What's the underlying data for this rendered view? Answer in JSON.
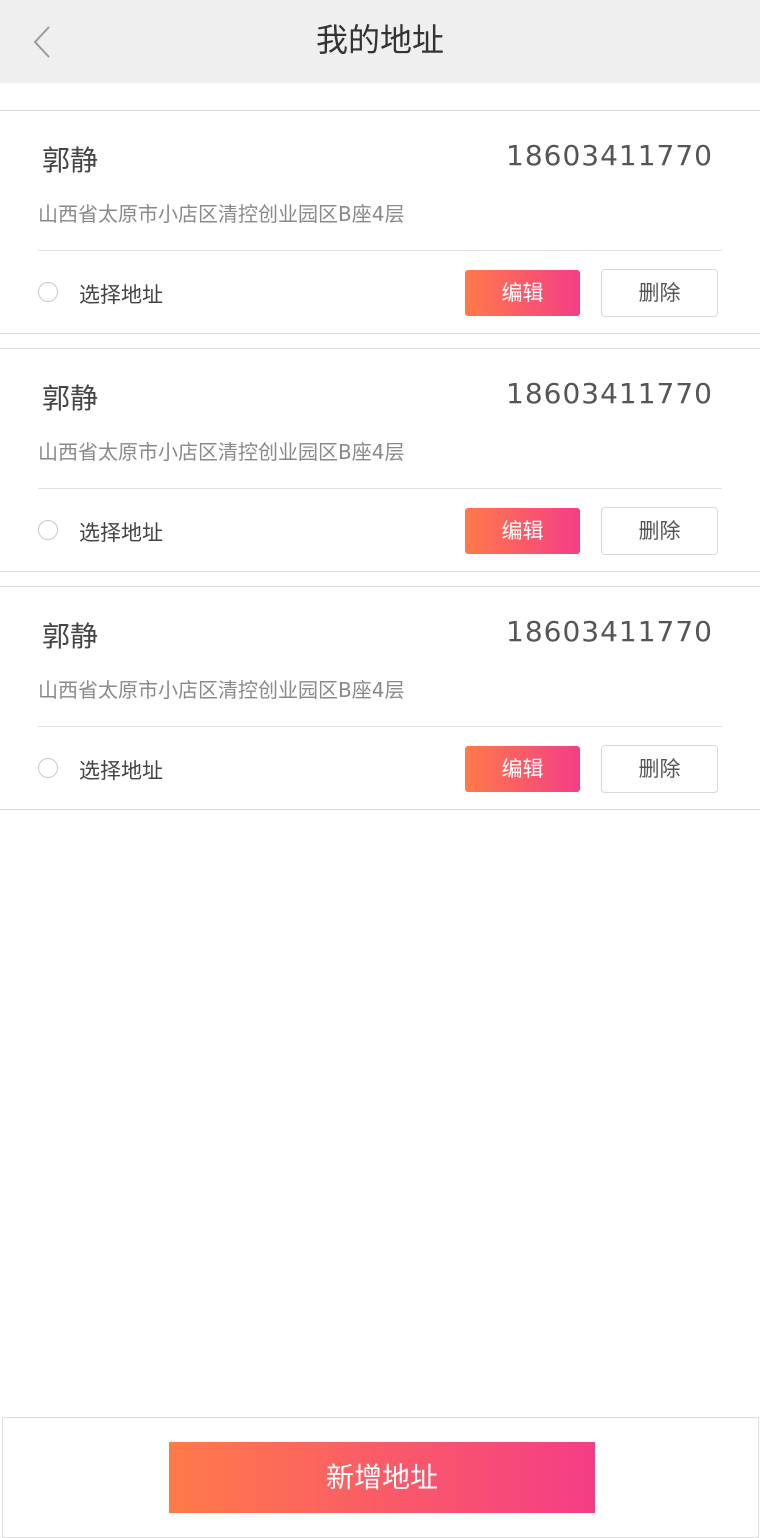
{
  "header": {
    "title": "我的地址",
    "back_icon": "chevron-left-icon"
  },
  "addresses": [
    {
      "name": "郭静",
      "phone": "18603411770",
      "address": "山西省太原市小店区清控创业园区B座4层",
      "select_label": "选择地址",
      "edit_label": "编辑",
      "delete_label": "删除"
    },
    {
      "name": "郭静",
      "phone": "18603411770",
      "address": "山西省太原市小店区清控创业园区B座4层",
      "select_label": "选择地址",
      "edit_label": "编辑",
      "delete_label": "删除"
    },
    {
      "name": "郭静",
      "phone": "18603411770",
      "address": "山西省太原市小店区清控创业园区B座4层",
      "select_label": "选择地址",
      "edit_label": "编辑",
      "delete_label": "删除"
    }
  ],
  "footer": {
    "add_label": "新增地址"
  },
  "colors": {
    "header_bg": "#efefef",
    "gradient_start": "#ff7a49",
    "gradient_end": "#f43d86",
    "divider": "#dddddd"
  }
}
